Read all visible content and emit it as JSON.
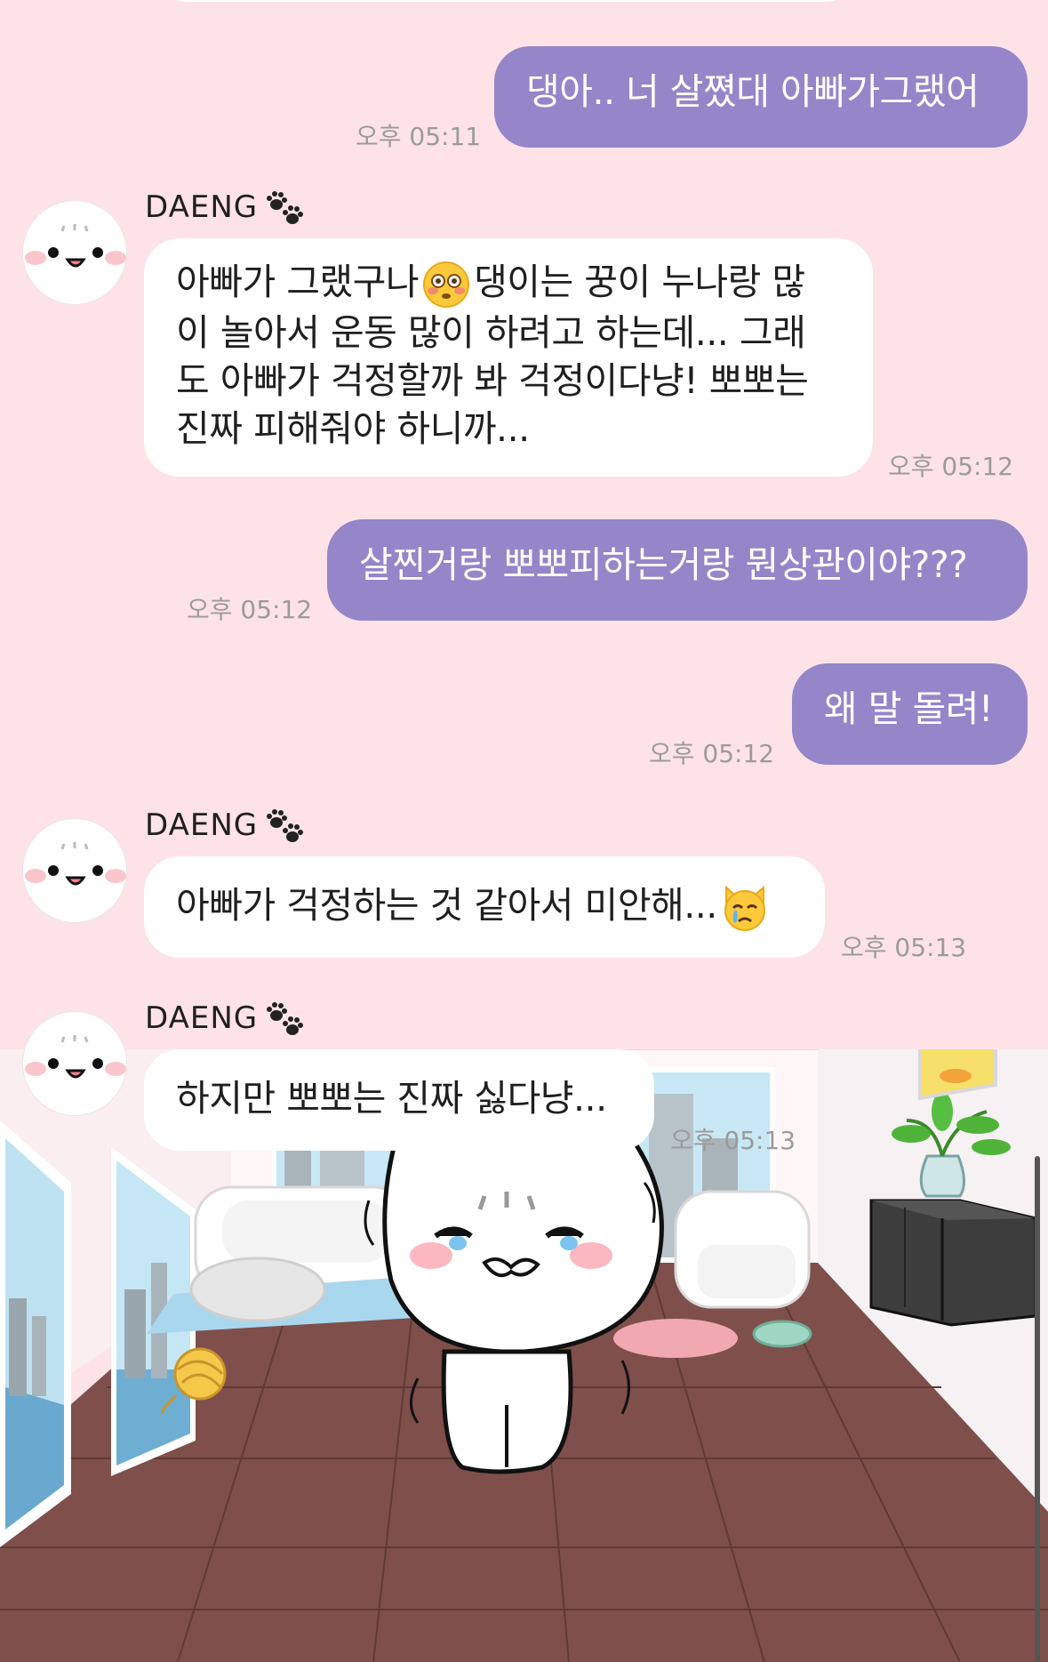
{
  "messages": [
    {
      "side": "out",
      "text": "댕아.. 너 살쪘대 아빠가그랬어",
      "time": "오후 05:11"
    },
    {
      "side": "in",
      "sender": "DAENG",
      "lines": [
        "아빠가 그랬구나",
        "댕이는 꿍이 누나랑 많",
        "이 놀아서 운동 많이 하려고 하는데... 그래",
        "도 아빠가 걱정할까 봐 걱정이다냥! 뽀뽀는",
        "진짜 피해줘야 하니까..."
      ],
      "time": "오후 05:12"
    },
    {
      "side": "out",
      "text": "살찐거랑 뽀뽀피하는거랑 뭔상관이야???",
      "time": "오후 05:12"
    },
    {
      "side": "out",
      "text": "왜 말 돌려!",
      "time": "오후 05:12"
    },
    {
      "side": "in",
      "sender": "DAENG",
      "text": "아빠가 걱정하는 것 같아서 미안해...",
      "time": "오후 05:13"
    },
    {
      "side": "in",
      "sender": "DAENG",
      "text": "하지만 뽀뽀는 진짜 싫다냥...",
      "time": "오후 05:13"
    }
  ],
  "emojis": [
    "flushed-face",
    "crying-cat-face"
  ],
  "icons": {
    "sender_badge": "paw-prints-icon",
    "avatar": "cat-face-avatar"
  },
  "colors": {
    "background": "#fde3e8",
    "outgoing_bubble": "#9486c8",
    "incoming_bubble": "#ffffff",
    "timestamp": "#9b9b9b"
  }
}
